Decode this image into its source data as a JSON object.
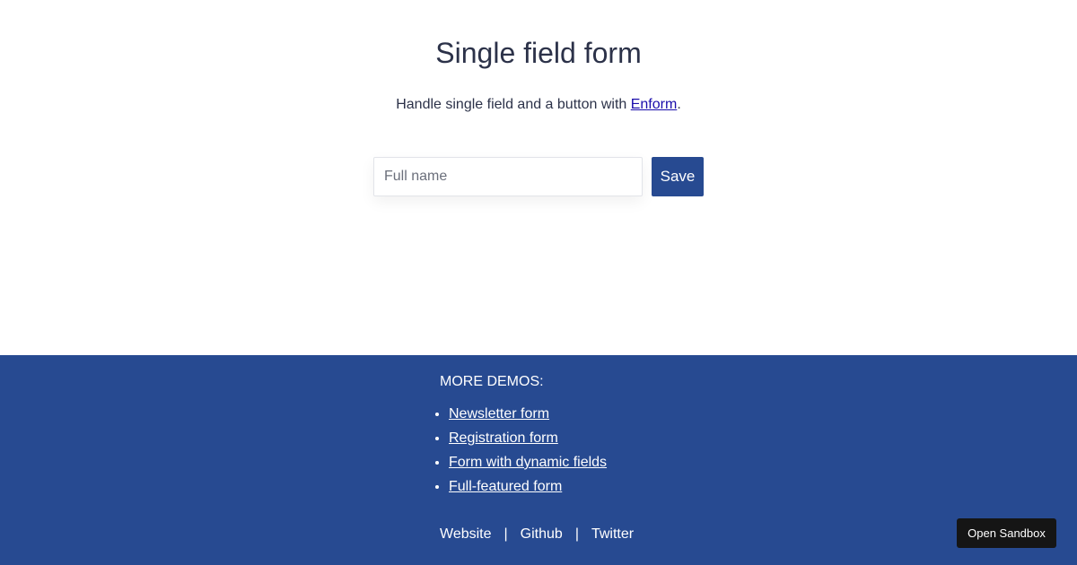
{
  "main": {
    "title": "Single field form",
    "description_prefix": "Handle single field and a button with ",
    "description_link": "Enform",
    "description_suffix": ".",
    "form": {
      "input_placeholder": "Full name",
      "input_value": "",
      "save_label": "Save"
    }
  },
  "footer": {
    "heading": "MORE DEMOS:",
    "demos": [
      {
        "label": "Newsletter form"
      },
      {
        "label": "Registration form"
      },
      {
        "label": "Form with dynamic fields"
      },
      {
        "label": "Full-featured form"
      }
    ],
    "links": [
      {
        "label": "Website"
      },
      {
        "label": "Github"
      },
      {
        "label": "Twitter"
      }
    ],
    "separator": "|"
  },
  "sandbox": {
    "label": "Open Sandbox"
  },
  "colors": {
    "footer_background": "#274a91",
    "button_background": "#274a91",
    "link": "#1a0dab",
    "text": "#2c3249",
    "sandbox_background": "#151515"
  }
}
